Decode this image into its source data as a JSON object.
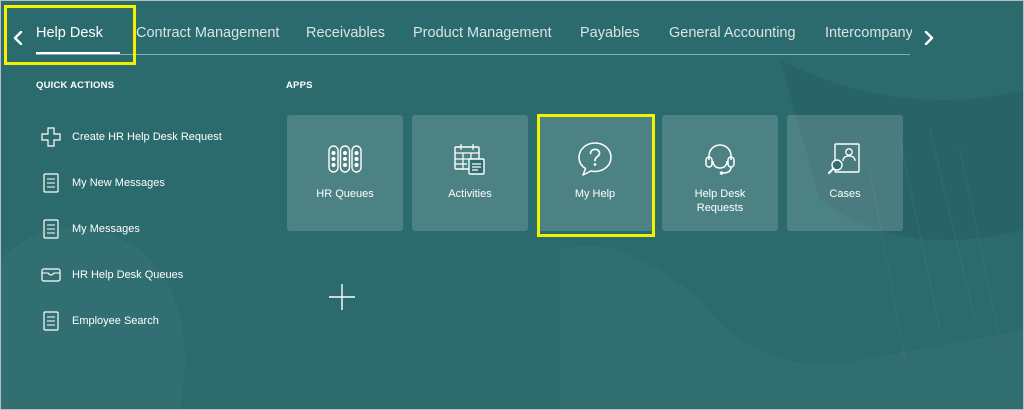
{
  "nav": {
    "tabs": [
      {
        "label": "Help Desk",
        "active": true
      },
      {
        "label": "Contract Management"
      },
      {
        "label": "Receivables"
      },
      {
        "label": "Product Management"
      },
      {
        "label": "Payables"
      },
      {
        "label": "General Accounting"
      },
      {
        "label": "Intercompany Accounting"
      }
    ],
    "prev_icon": "chevron-left-icon",
    "next_icon": "chevron-right-icon"
  },
  "quick_actions": {
    "title": "QUICK ACTIONS",
    "items": [
      {
        "label": "Create HR Help Desk Request",
        "icon": "plus-icon"
      },
      {
        "label": "My New Messages",
        "icon": "document-icon"
      },
      {
        "label": "My Messages",
        "icon": "document-icon"
      },
      {
        "label": "HR Help Desk Queues",
        "icon": "inbox-icon"
      },
      {
        "label": "Employee Search",
        "icon": "document-icon"
      }
    ]
  },
  "apps": {
    "title": "APPS",
    "tiles": [
      {
        "label": "HR Queues",
        "icon": "queues-icon"
      },
      {
        "label": "Activities",
        "icon": "calendar-icon"
      },
      {
        "label": "My Help",
        "icon": "help-bubble-icon"
      },
      {
        "label": "Help Desk Requests",
        "icon": "headset-icon"
      },
      {
        "label": "Cases",
        "icon": "case-icon"
      }
    ],
    "add_icon": "add-app-icon"
  },
  "colors": {
    "background": "#2b6a6d",
    "highlight": "#f2f200",
    "tile_bg": "rgba(255,255,255,0.16)"
  }
}
